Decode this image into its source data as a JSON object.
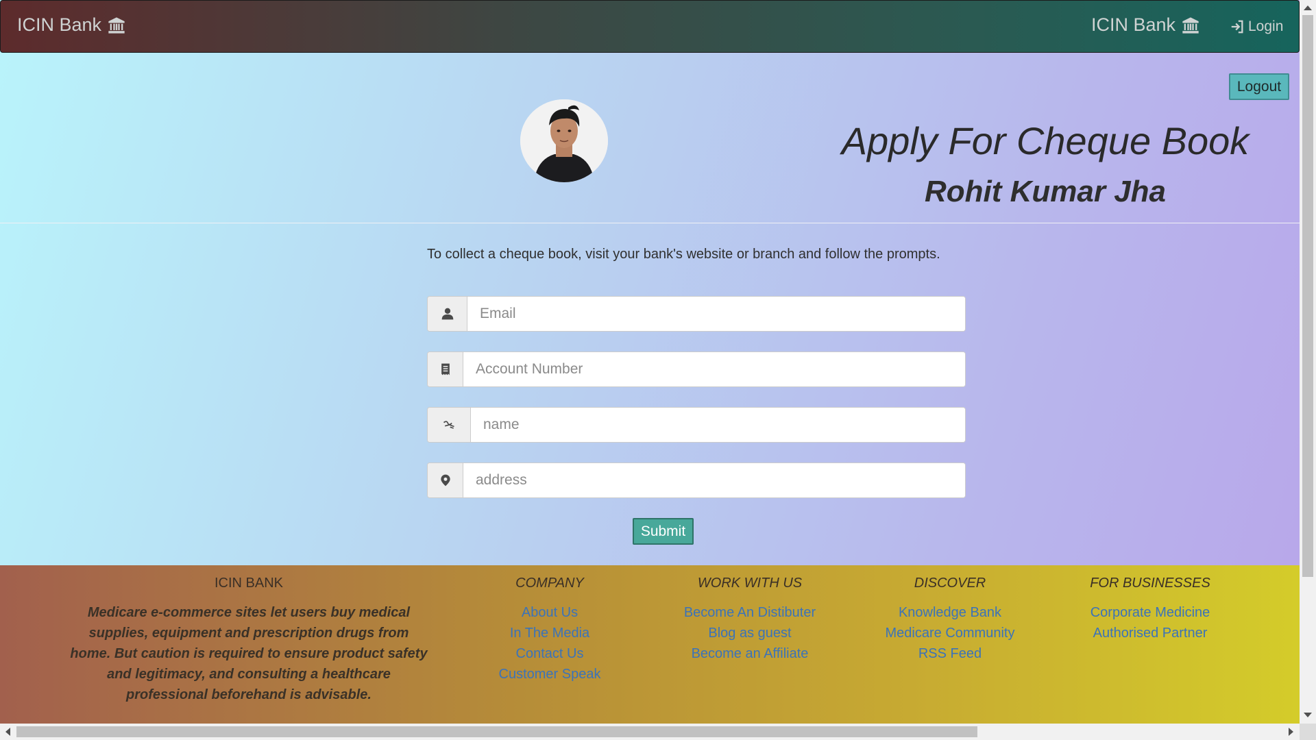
{
  "navbar": {
    "brand": "ICIN Bank",
    "brand_right": "ICIN Bank",
    "login": "Login"
  },
  "header": {
    "logout": "Logout",
    "title": "Apply For Cheque Book",
    "user_name": "Rohit Kumar Jha"
  },
  "form": {
    "info_text": "To collect a cheque book, visit your bank's website or branch and follow the prompts.",
    "email_placeholder": "Email",
    "account_placeholder": "Account Number",
    "name_placeholder": "name",
    "address_placeholder": "address",
    "submit": "Submit"
  },
  "footer": {
    "about_title": "ICIN BANK",
    "about_text": "Medicare e-commerce sites let users buy medical supplies, equipment and prescription drugs from home. But caution is required to ensure product safety and legitimacy, and consulting a healthcare professional beforehand is advisable.",
    "columns": [
      {
        "title": "COMPANY",
        "links": [
          "About Us",
          "In The Media",
          "Contact Us",
          "Customer Speak"
        ]
      },
      {
        "title": "WORK WITH US",
        "links": [
          "Become An Distibuter",
          "Blog as guest",
          "Become an Affiliate"
        ]
      },
      {
        "title": "DISCOVER",
        "links": [
          "Knowledge Bank",
          "Medicare Community",
          "RSS Feed"
        ]
      },
      {
        "title": "FOR BUSINESSES",
        "links": [
          "Corporate Medicine",
          "Authorised Partner"
        ]
      }
    ]
  },
  "icons": {
    "bank": "bank-icon",
    "login": "login-icon",
    "user": "user-icon",
    "receipt": "receipt-icon",
    "signature": "signature-icon",
    "location": "map-marker-icon"
  },
  "colors": {
    "submit": "#48a89a",
    "logout": "#5ab8bc",
    "link": "#3b73b9"
  }
}
